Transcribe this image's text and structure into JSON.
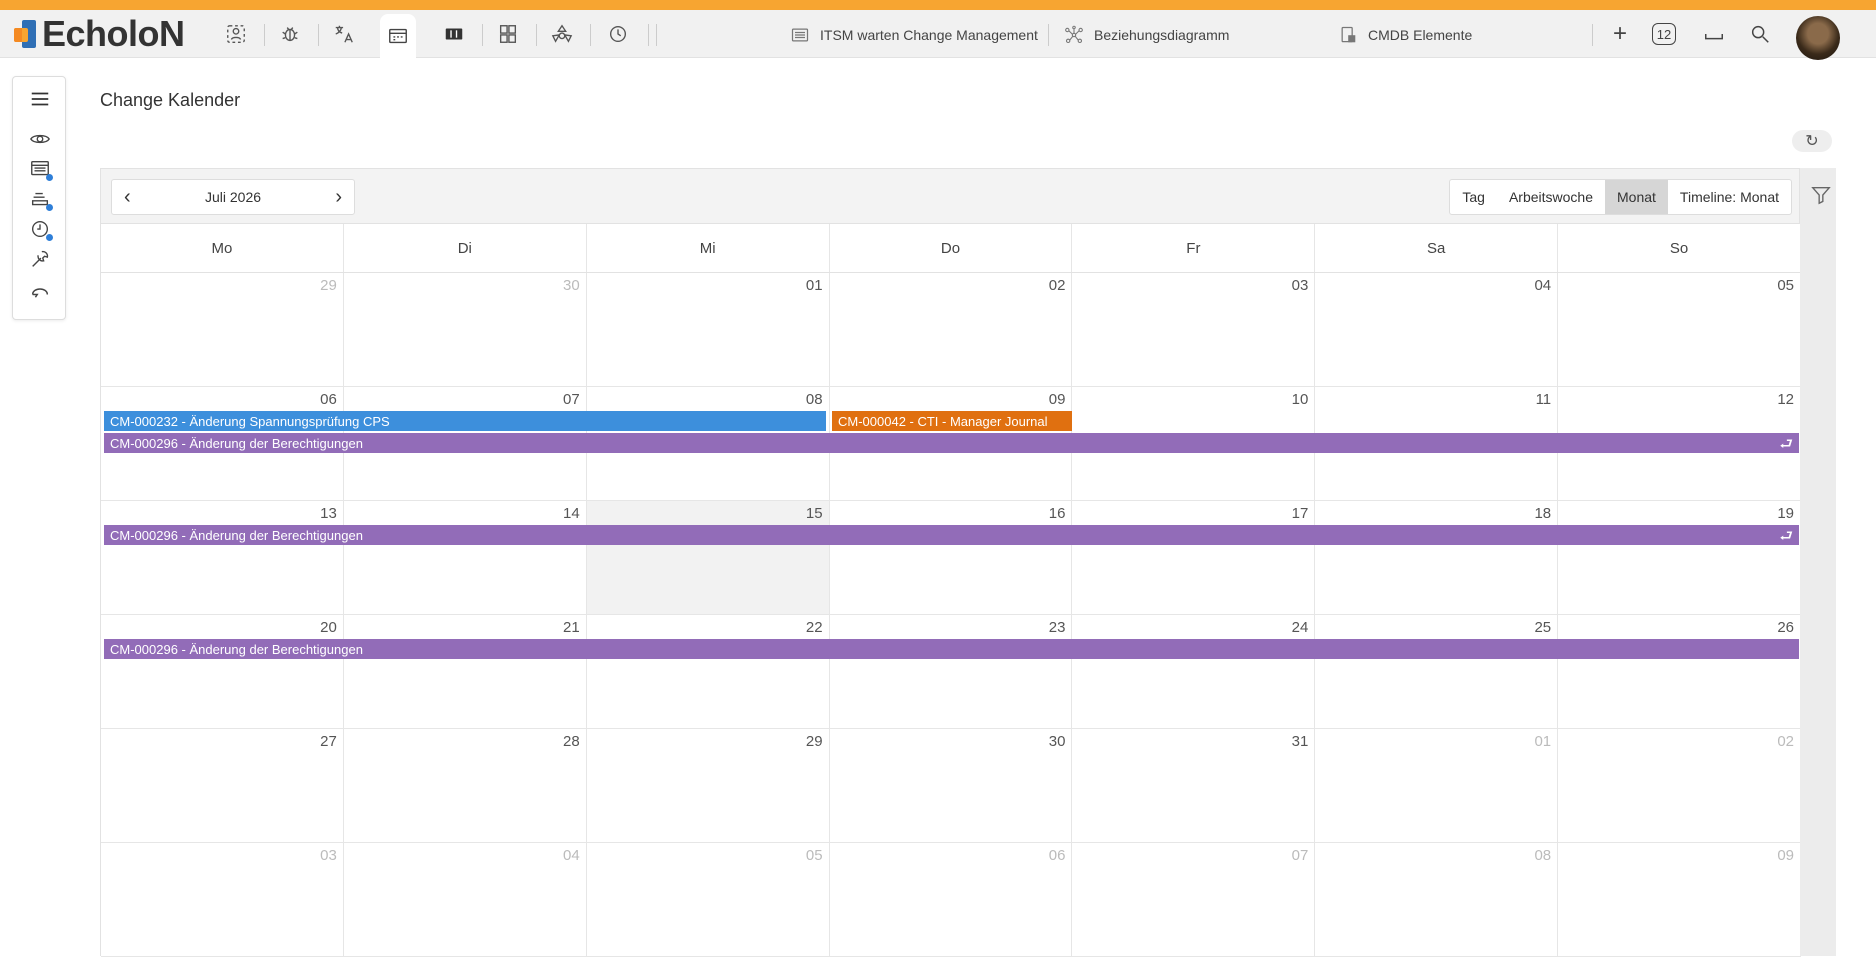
{
  "app": {
    "name": "EcholoN"
  },
  "toolbar": {
    "tools": [
      "user-search-icon",
      "bug-icon",
      "translate-icon",
      "calendar-board-icon",
      "columns-icon",
      "grid-icon",
      "recycle-icon",
      "clock-icon"
    ],
    "tabs": [
      {
        "label": "ITSM warten Change Management",
        "icon": "list-icon"
      },
      {
        "label": "Beziehungsdiagramm",
        "icon": "network-icon"
      },
      {
        "label": "CMDB Elemente",
        "icon": "database-icon"
      }
    ],
    "badge_count": "12"
  },
  "sidebar": {
    "items": [
      "menu-icon",
      "eye-icon",
      "list-icon",
      "queue-icon",
      "clock-icon",
      "wrench-icon",
      "chat-icon"
    ]
  },
  "page": {
    "title": "Change Kalender",
    "refresh_icon": "↻"
  },
  "calendar": {
    "period": "Juli 2026",
    "prev": "‹",
    "next": "›",
    "views": [
      "Tag",
      "Arbeitswoche",
      "Monat",
      "Timeline: Monat"
    ],
    "selected_view": "Monat",
    "weekdays": [
      "Mo",
      "Di",
      "Mi",
      "Do",
      "Fr",
      "Sa",
      "So"
    ],
    "weeks": [
      [
        "29",
        "30",
        "01",
        "02",
        "03",
        "04",
        "05"
      ],
      [
        "06",
        "07",
        "08",
        "09",
        "10",
        "11",
        "12"
      ],
      [
        "13",
        "14",
        "15",
        "16",
        "17",
        "18",
        "19"
      ],
      [
        "20",
        "21",
        "22",
        "23",
        "24",
        "25",
        "26"
      ],
      [
        "27",
        "28",
        "29",
        "30",
        "31",
        "01",
        "02"
      ],
      [
        "03",
        "04",
        "05",
        "06",
        "07",
        "08",
        "09"
      ]
    ],
    "events": {
      "blue": "CM-000232 - Änderung Spannungsprüfung CPS",
      "orange": "CM-000042 - CTI - Manager Journal",
      "purple": "CM-000296 - Änderung der Berechtigungen"
    },
    "colors": {
      "blue": "#3d8fdc",
      "orange": "#e07010",
      "purple": "#926cb8",
      "accent": "#f7a531"
    }
  }
}
